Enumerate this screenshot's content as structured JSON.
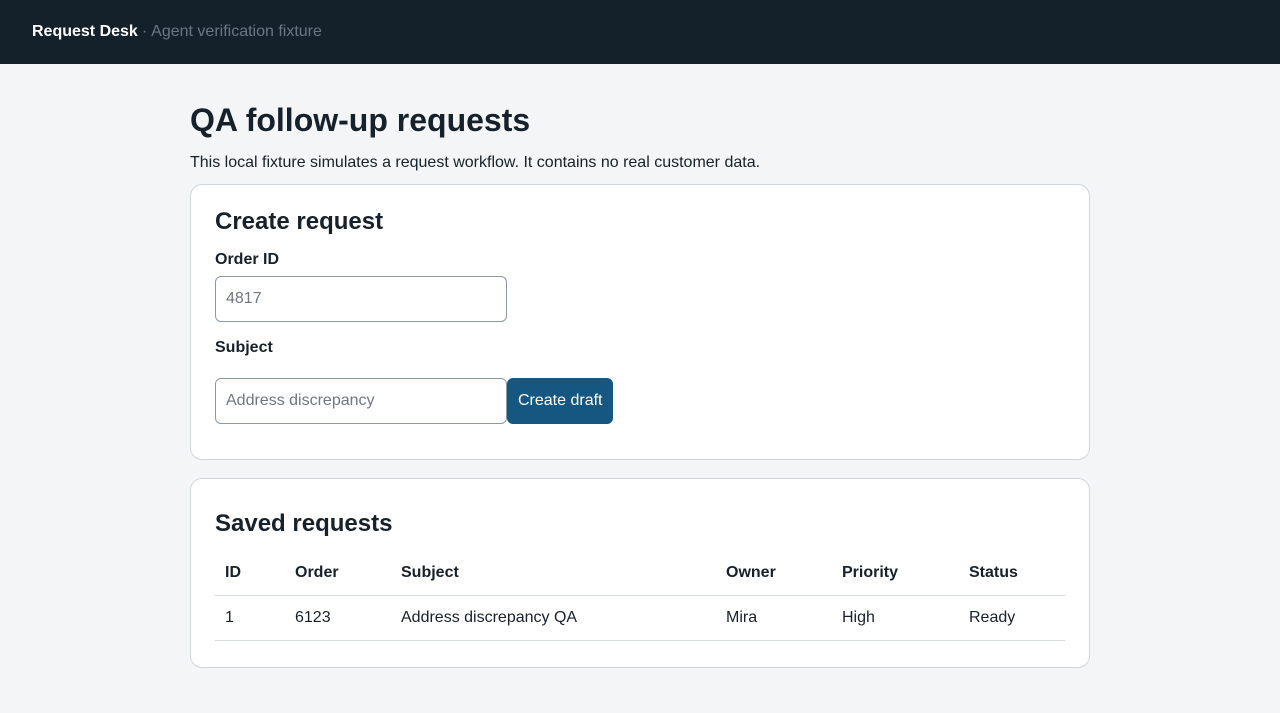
{
  "header": {
    "brand": "Request Desk",
    "separator": "·",
    "subtitle": "Agent verification fixture"
  },
  "page": {
    "title": "QA follow-up requests",
    "intro": "This local fixture simulates a request workflow. It contains no real customer data."
  },
  "create_card": {
    "title": "Create request",
    "order_label": "Order ID",
    "order_placeholder": "4817",
    "order_value": "",
    "subject_label": "Subject",
    "subject_placeholder": "Address discrepancy",
    "subject_value": "",
    "submit_label": "Create draft"
  },
  "saved_card": {
    "title": "Saved requests",
    "columns": [
      "ID",
      "Order",
      "Subject",
      "Owner",
      "Priority",
      "Status"
    ],
    "rows": [
      {
        "id": "1",
        "order": "6123",
        "subject": "Address discrepancy QA",
        "owner": "Mira",
        "priority": "High",
        "status": "Ready"
      }
    ]
  },
  "colors": {
    "topbar": "#14202a",
    "accent": "#155780",
    "background": "#f3f5f7"
  }
}
